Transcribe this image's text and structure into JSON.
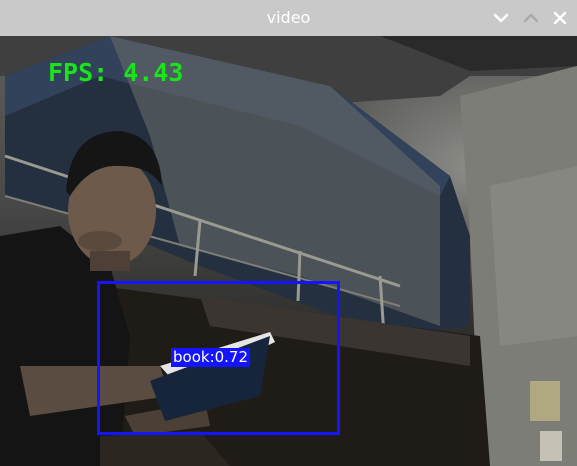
{
  "window": {
    "title": "video",
    "controls": {
      "minimize": "chevron-down-icon",
      "maximize": "chevron-up-icon",
      "close": "close-icon"
    }
  },
  "overlay": {
    "fps_text": "FPS: 4.43",
    "fps_color": "#19e61a"
  },
  "detections": [
    {
      "label": "book:0.72",
      "box_color": "#1414ff"
    }
  ]
}
